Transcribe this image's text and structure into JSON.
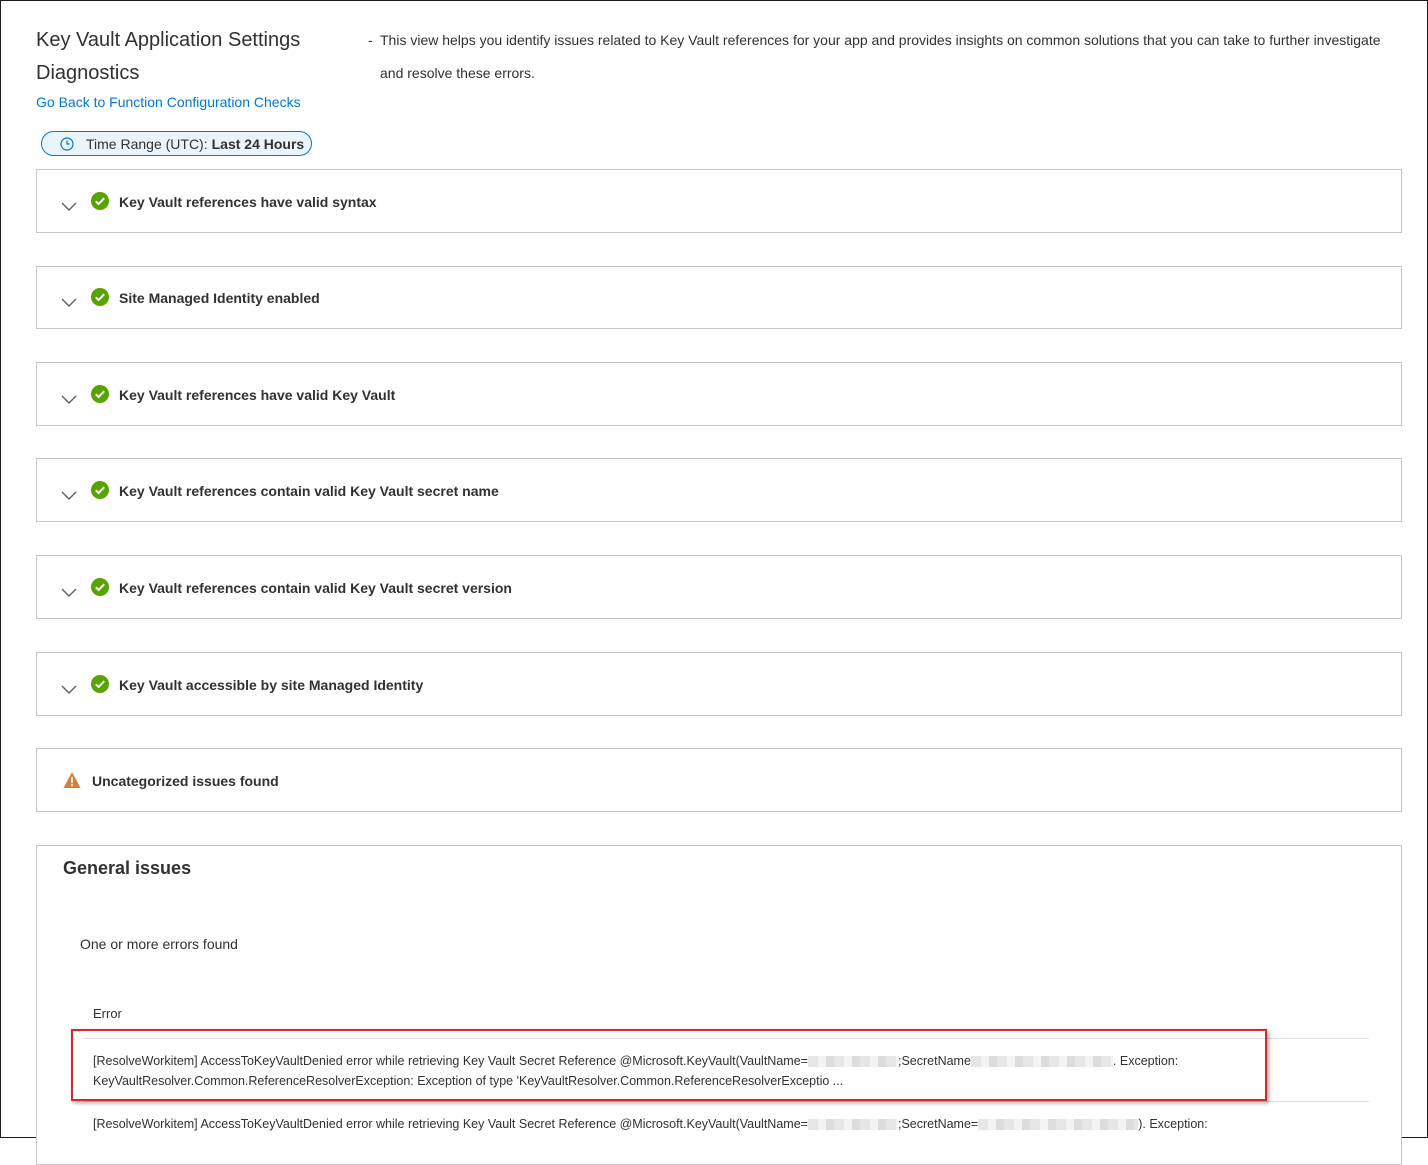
{
  "header": {
    "title_line1": "Key Vault Application Settings",
    "title_line2": "Diagnostics",
    "description_line1": "This view helps you identify issues related to Key Vault references for your app and provides insights on common solutions that you can take to further investigate",
    "description_line2": "and resolve these errors.",
    "back_link": "Go Back to Function Configuration Checks",
    "time_range_label": "Time Range (UTC):",
    "time_range_value": "Last 24 Hours"
  },
  "checks": [
    {
      "label": "Key Vault references have valid syntax",
      "status": "success",
      "icon": "check-circle-icon"
    },
    {
      "label": "Site Managed Identity enabled",
      "status": "success",
      "icon": "check-circle-icon"
    },
    {
      "label": "Key Vault references have valid Key Vault",
      "status": "success",
      "icon": "check-circle-icon"
    },
    {
      "label": "Key Vault references contain valid Key Vault secret name",
      "status": "success",
      "icon": "check-circle-icon"
    },
    {
      "label": "Key Vault references contain valid Key Vault secret version",
      "status": "success",
      "icon": "check-circle-icon"
    },
    {
      "label": "Key Vault accessible by site Managed Identity",
      "status": "success",
      "icon": "check-circle-icon"
    }
  ],
  "warning": {
    "label": "Uncategorized issues found",
    "status": "warning",
    "icon": "warning-icon"
  },
  "general": {
    "title": "General issues",
    "summary": "One or more errors found",
    "column_header": "Error",
    "rows": [
      {
        "part1": "[ResolveWorkitem] AccessToKeyVaultDenied error while retrieving Key Vault Secret Reference @Microsoft.KeyVault(VaultName=",
        "part2": ";SecretName",
        "part3": ". Exception:",
        "line2": "KeyVaultResolver.Common.ReferenceResolverException: Exception of type 'KeyVaultResolver.Common.ReferenceResolverExceptio ..."
      },
      {
        "part1": "[ResolveWorkitem] AccessToKeyVaultDenied error while retrieving Key Vault Secret Reference @Microsoft.KeyVault(VaultName=",
        "part2": ";SecretName=",
        "part3": "). Exception:"
      }
    ]
  },
  "colors": {
    "accent": "#0078d4",
    "success": "#57a300",
    "warning": "#d67f3c",
    "highlight": "#d6262e"
  }
}
